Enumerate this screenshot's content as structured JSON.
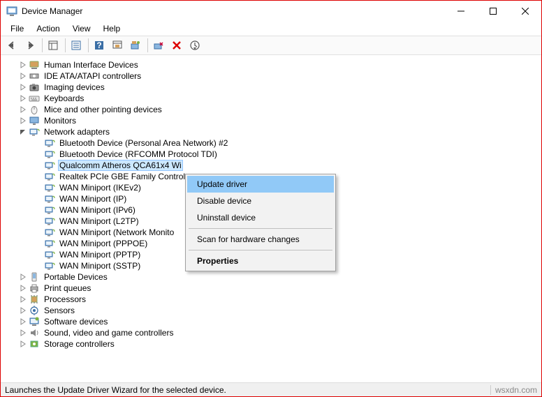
{
  "title": "Device Manager",
  "menubar": [
    "File",
    "Action",
    "View",
    "Help"
  ],
  "categories": [
    {
      "name": "Human Interface Devices",
      "expanded": false,
      "icon": "hid"
    },
    {
      "name": "IDE ATA/ATAPI controllers",
      "expanded": false,
      "icon": "ide"
    },
    {
      "name": "Imaging devices",
      "expanded": false,
      "icon": "imaging"
    },
    {
      "name": "Keyboards",
      "expanded": false,
      "icon": "keyboard"
    },
    {
      "name": "Mice and other pointing devices",
      "expanded": false,
      "icon": "mouse"
    },
    {
      "name": "Monitors",
      "expanded": false,
      "icon": "monitor"
    },
    {
      "name": "Network adapters",
      "expanded": true,
      "icon": "network",
      "children": [
        "Bluetooth Device (Personal Area Network) #2",
        "Bluetooth Device (RFCOMM Protocol TDI)",
        "Qualcomm Atheros QCA61x4 Wi",
        "Realtek PCIe GBE Family Control",
        "WAN Miniport (IKEv2)",
        "WAN Miniport (IP)",
        "WAN Miniport (IPv6)",
        "WAN Miniport (L2TP)",
        "WAN Miniport (Network Monito",
        "WAN Miniport (PPPOE)",
        "WAN Miniport (PPTP)",
        "WAN Miniport (SSTP)"
      ],
      "selected_index": 2
    },
    {
      "name": "Portable Devices",
      "expanded": false,
      "icon": "portable"
    },
    {
      "name": "Print queues",
      "expanded": false,
      "icon": "printer"
    },
    {
      "name": "Processors",
      "expanded": false,
      "icon": "cpu"
    },
    {
      "name": "Sensors",
      "expanded": false,
      "icon": "sensor"
    },
    {
      "name": "Software devices",
      "expanded": false,
      "icon": "software"
    },
    {
      "name": "Sound, video and game controllers",
      "expanded": false,
      "icon": "sound"
    },
    {
      "name": "Storage controllers",
      "expanded": false,
      "icon": "storage"
    }
  ],
  "context_menu": {
    "items": [
      {
        "label": "Update driver",
        "hover": true
      },
      {
        "label": "Disable device"
      },
      {
        "label": "Uninstall device"
      },
      {
        "sep": true
      },
      {
        "label": "Scan for hardware changes"
      },
      {
        "sep": true
      },
      {
        "label": "Properties",
        "bold": true
      }
    ]
  },
  "status_left": "Launches the Update Driver Wizard for the selected device.",
  "status_right": "wsxdn.com"
}
